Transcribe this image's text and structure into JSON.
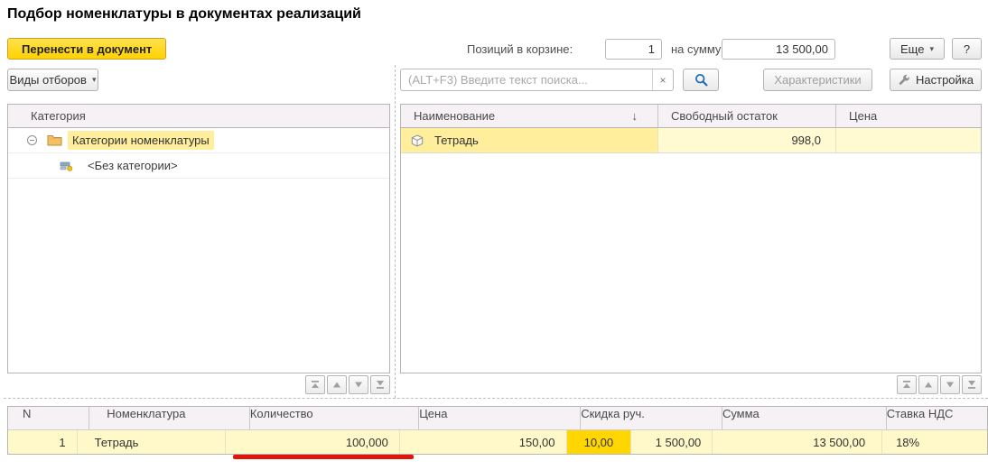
{
  "title": "Подбор номенклатуры в документах реализаций",
  "toolbar": {
    "transfer_button": "Перенести в документ",
    "cart_label": "Позиций в корзине:",
    "cart_count": "1",
    "sum_label": "на сумму:",
    "sum_value": "13 500,00",
    "more_button": "Еще",
    "more_arrow": "▾",
    "help_button": "?"
  },
  "filter_bar": {
    "filter_types_button": "Виды отборов",
    "filter_types_arrow": "▾",
    "search_placeholder": "(ALT+F3) Введите текст поиска...",
    "clear_button": "×",
    "characteristics_button": "Характеристики",
    "settings_button": "Настройка"
  },
  "category_panel": {
    "header": "Категория",
    "root_item": "Категории номенклатуры",
    "child_item": "<Без категории>"
  },
  "items_table": {
    "columns": {
      "name": "Наименование",
      "stock": "Свободный остаток",
      "price": "Цена"
    },
    "sort_arrow": "↓",
    "row": {
      "name": "Тетрадь",
      "stock": "998,0",
      "price": ""
    }
  },
  "cart_table": {
    "columns": {
      "n": "N",
      "nomenclature": "Номенклатура",
      "quantity": "Количество",
      "price": "Цена",
      "discount": "Скидка руч.",
      "sum": "Сумма",
      "vat": "Ставка НДС"
    },
    "row": {
      "n": "1",
      "nomenclature": "Тетрадь",
      "quantity": "100,000",
      "price": "150,00",
      "discount_percent": "10,00",
      "discount_sum": "1 500,00",
      "sum": "13 500,00",
      "vat": "18%"
    }
  },
  "colors": {
    "primary_button": "#FFD600",
    "row_selection": "#FFF8C9",
    "active_cell": "#FFEE9C",
    "editing_cell": "#FFD600",
    "annotation_red": "#E2150B"
  }
}
